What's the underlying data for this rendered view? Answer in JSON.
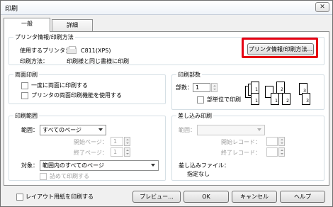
{
  "window": {
    "title": "印刷",
    "close_symbol": "✕"
  },
  "tabs": [
    {
      "label": "一般"
    },
    {
      "label": "詳細"
    }
  ],
  "printer_group": {
    "title": "プリンタ情報/印刷方法",
    "printer_label": "使用するプリンタ：",
    "printer_name": "C811(XPS)",
    "method_label": "印刷方法：",
    "method_value": "印刷様と同じ書様に印刷",
    "info_button": "プリンタ情報/印刷方法..."
  },
  "duplex_group": {
    "title": "両面印刷",
    "option1": "一度に両面に印刷する",
    "option2": "プリンタの両面印刷機能を使用する"
  },
  "copies_group": {
    "title": "印刷部数",
    "copies_label": "部数：",
    "copies_value": "1",
    "collate_label": "部単位で印刷",
    "page_labels": [
      "1",
      "1",
      "1",
      "2",
      "2",
      "3",
      "3"
    ]
  },
  "range_group": {
    "title": "印刷範囲",
    "range_label": "範囲：",
    "range_value": "すべてのページ",
    "start_label": "開始ページ：",
    "start_value": "1",
    "end_label": "終了ページ：",
    "end_value": "1",
    "target_label": "対象：",
    "target_value": "範囲内のすべてのページ",
    "condense_label": "詰めて印刷する"
  },
  "merge_group": {
    "title": "差し込み印刷",
    "range_label": "範囲：",
    "start_label": "開始レコード：",
    "end_label": "終了レコード：",
    "file_label": "差し込みファイル：",
    "file_value": "指定なし"
  },
  "footer": {
    "layout_checkbox": "レイアウト用紙を印刷する",
    "preview_button": "プレビュー...",
    "ok_button": "OK",
    "cancel_button": "キャンセル",
    "help_button": "ヘルプ"
  },
  "colors": {
    "highlight": "#e60012"
  }
}
